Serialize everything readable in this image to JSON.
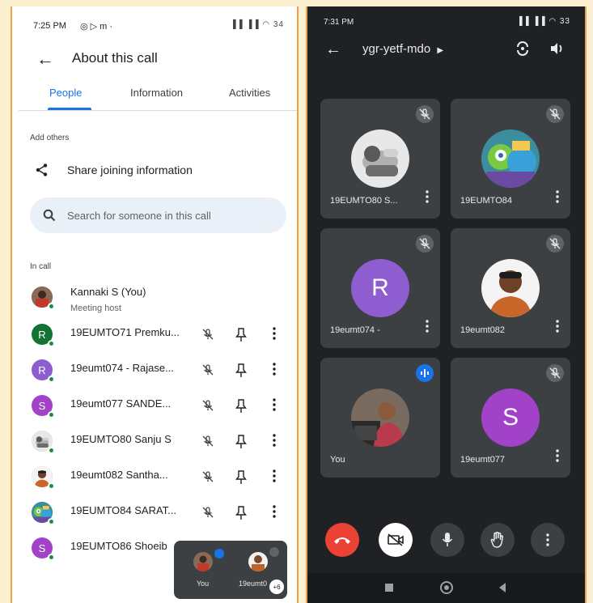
{
  "left_phone": {
    "status_time": "7:25 PM",
    "status_icons": "◎ ▷ m ·",
    "status_right": "▐▐ ▐▐ ◠ 34",
    "title": "About this call",
    "tabs": [
      "People",
      "Information",
      "Activities"
    ],
    "add_others_label": "Add others",
    "share_label": "Share joining information",
    "search_placeholder": "Search for someone in this call",
    "in_call_label": "In call",
    "host": {
      "name": "Kannaki S (You)",
      "role": "Meeting host"
    },
    "participants": [
      {
        "initial": "R",
        "name": "19EUMTO71 Premku...",
        "color": "#137333",
        "photo": ""
      },
      {
        "initial": "R",
        "name": "19eumt074 - Rajase...",
        "color": "#8e5ed0",
        "photo": ""
      },
      {
        "initial": "S",
        "name": "19eumt077 SANDE...",
        "color": "#a142c9",
        "photo": ""
      },
      {
        "initial": "",
        "name": "19EUMTO80 Sanju S",
        "color": "#9aa0a6",
        "photo": "robot"
      },
      {
        "initial": "",
        "name": "19eumt082 Santha...",
        "color": "#c26a2d",
        "photo": "man"
      },
      {
        "initial": "",
        "name": "19EUMTO84 SARAT...",
        "color": "#4a9b6e",
        "photo": "monsters"
      },
      {
        "initial": "S",
        "name": "19EUMTO86 Shoeib",
        "color": "#a142c9",
        "photo": ""
      }
    ],
    "pip": {
      "you_label": "You",
      "other_label": "19eumt0",
      "count": "+6"
    }
  },
  "right_phone": {
    "status_time": "7:31 PM",
    "status_right": "▐▐ ▐▐ ◠ 33",
    "meeting_code": "ygr-yetf-mdo",
    "tiles": [
      {
        "name": "19EUMTO80 S...",
        "type": "photo",
        "photo": "robot",
        "initial": "",
        "muted": true,
        "menu": true
      },
      {
        "name": "19EUMTO84",
        "type": "photo",
        "photo": "monsters",
        "initial": "",
        "muted": true,
        "menu": true
      },
      {
        "name": "19eumt074 -",
        "type": "initial",
        "photo": "",
        "initial": "R",
        "color": "#8e5ed0",
        "muted": true,
        "menu": true
      },
      {
        "name": "19eumt082",
        "type": "photo",
        "photo": "man",
        "initial": "",
        "muted": true,
        "menu": true
      },
      {
        "name": "You",
        "type": "photo",
        "photo": "woman",
        "initial": "",
        "muted": false,
        "menu": false
      },
      {
        "name": "19eumt077",
        "type": "initial",
        "photo": "",
        "initial": "S",
        "color": "#a142c9",
        "muted": true,
        "menu": true
      }
    ],
    "colors": {
      "end_call": "#ea4335",
      "button_bg": "#3c4043",
      "accent": "#1a73e8"
    }
  }
}
